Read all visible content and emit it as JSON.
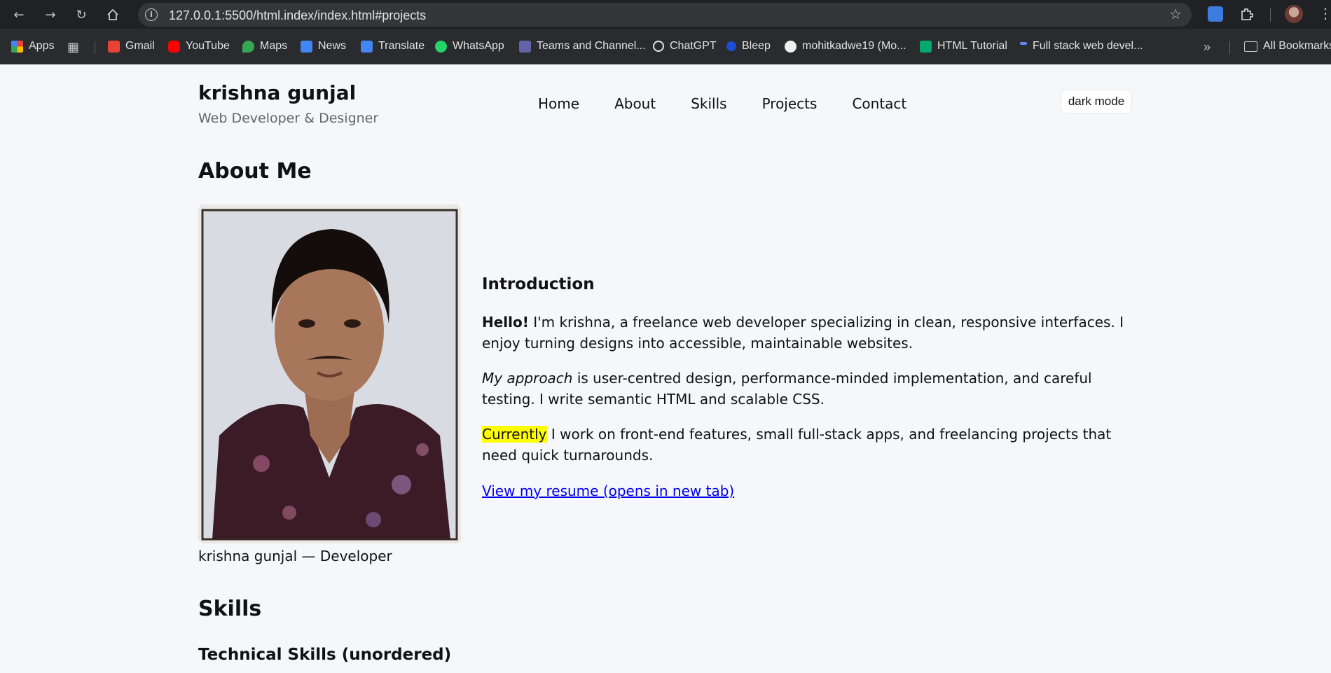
{
  "browser": {
    "url": "127.0.0.1:5500/html.index/index.html#projects",
    "bookmarks": [
      {
        "label": "Apps",
        "icon": "apps-grid-icon"
      },
      {
        "label": "Gmail",
        "icon": "gmail-icon"
      },
      {
        "label": "YouTube",
        "icon": "youtube-icon"
      },
      {
        "label": "Maps",
        "icon": "maps-icon"
      },
      {
        "label": "News",
        "icon": "news-icon"
      },
      {
        "label": "Translate",
        "icon": "translate-icon"
      },
      {
        "label": "WhatsApp",
        "icon": "whatsapp-icon"
      },
      {
        "label": "Teams and Channel...",
        "icon": "teams-icon"
      },
      {
        "label": "ChatGPT",
        "icon": "chatgpt-icon"
      },
      {
        "label": "Bleep",
        "icon": "bleep-icon"
      },
      {
        "label": "mohitkadwe19 (Mo...",
        "icon": "github-icon"
      },
      {
        "label": "HTML Tutorial",
        "icon": "w3schools-icon"
      },
      {
        "label": "Full stack web devel...",
        "icon": "bookmark-icon"
      }
    ],
    "all_bookmarks": "All Bookmarks"
  },
  "site": {
    "title": "krishna gunjal",
    "subtitle": "Web Developer & Designer",
    "nav": [
      "Home",
      "About",
      "Skills",
      "Projects",
      "Contact"
    ],
    "dark_mode_label": "dark mode"
  },
  "about": {
    "heading": "About Me",
    "photo_caption": "krishna gunjal — Developer",
    "intro_heading": "Introduction",
    "p1_bold": "Hello!",
    "p1_rest": " I'm krishna, a freelance web developer specializing in clean, responsive interfaces. I enjoy turning designs into accessible, maintainable websites.",
    "p2_italic": "My approach",
    "p2_rest": " is user-centred design, performance-minded implementation, and careful testing. I write semantic HTML and scalable CSS.",
    "p3_highlight": "Currently",
    "p3_rest": " I work on front-end features, small full-stack apps, and freelancing projects that need quick turnarounds.",
    "resume_link": "View my resume (opens in new tab)"
  },
  "skills": {
    "heading": "Skills",
    "technical_heading": "Technical Skills (unordered)"
  },
  "colors": {
    "highlight": "#ffff00",
    "link": "#0000ee",
    "page_bg": "#f6f7fb"
  }
}
